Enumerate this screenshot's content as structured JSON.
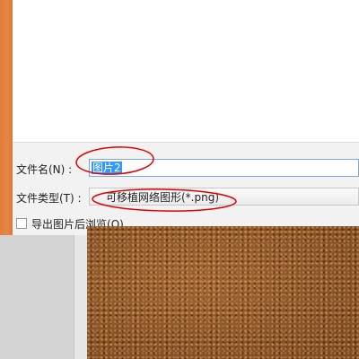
{
  "save_dialog": {
    "filename_label": "文件名(N) :",
    "filename_value": "图片2",
    "filetype_label": "文件类型(T) :",
    "filetype_value": "可移植网络图形(*.png)",
    "preview_checkbox": {
      "label_prefix": "导出图片后浏览(",
      "label_hotkey": "O",
      "label_suffix": ")",
      "checked": false
    }
  },
  "colors": {
    "accent_orange": "#e27d3c",
    "selection_blue": "#3399ff",
    "annotation_red": "#e00000",
    "leather_brown": "#8a5426"
  }
}
